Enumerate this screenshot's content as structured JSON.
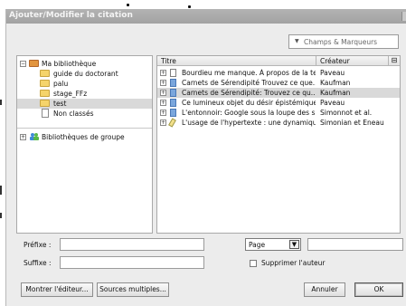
{
  "dialog": {
    "title": "Ajouter/Modifier la citation"
  },
  "search": {
    "placeholder": "Champs & Marqueurs"
  },
  "library": {
    "items": [
      {
        "label": "Ma bibliothèque",
        "icon": "library-folder-icon"
      },
      {
        "label": "guide du doctorant",
        "icon": "folder-icon"
      },
      {
        "label": "palu",
        "icon": "folder-icon"
      },
      {
        "label": "stage_FFz",
        "icon": "folder-icon"
      },
      {
        "label": "test",
        "icon": "folder-icon",
        "selected": true
      },
      {
        "label": "Non classés",
        "icon": "unfiled-icon"
      }
    ],
    "groups_label": "Bibliothèques de groupe"
  },
  "items_table": {
    "columns": {
      "title": "Titre",
      "creator": "Créateur"
    },
    "rows": [
      {
        "title": "Bourdieu me manque. À propos de la te...",
        "creator": "Paveau",
        "type": "book-icon"
      },
      {
        "title": "Carnets de Sérendipité Trouvez ce que...",
        "creator": "Kaufman",
        "type": "journal-article-icon"
      },
      {
        "title": "Carnets de Sérendipité: Trouvez ce qu...",
        "creator": "Kaufman",
        "type": "journal-article-icon",
        "selected": true
      },
      {
        "title": "Ce lumineux objet du désir épistémique",
        "creator": "Paveau",
        "type": "journal-article-icon"
      },
      {
        "title": "L'entonnoir: Google sous la loupe des s...",
        "creator": "Simonnot et al.",
        "type": "journal-article-icon"
      },
      {
        "title": "L'usage de l'hypertexte : une dynamiqu...",
        "creator": "Simonian et Eneau",
        "type": "web-page-icon"
      }
    ]
  },
  "citation": {
    "prefix_label": "Préfixe :",
    "suffix_label": "Suffixe :",
    "locator_selected": "Page",
    "suppress_author_label": "Supprimer l'auteur"
  },
  "buttons": {
    "show_editor": "Montrer l'éditeur...",
    "multiple_sources": "Sources multiples...",
    "cancel": "Annuler",
    "ok": "OK"
  },
  "colors": {
    "selection": "#d9d9d9",
    "titlebar": "#a9a9a9",
    "folder": "#f5d46b"
  }
}
